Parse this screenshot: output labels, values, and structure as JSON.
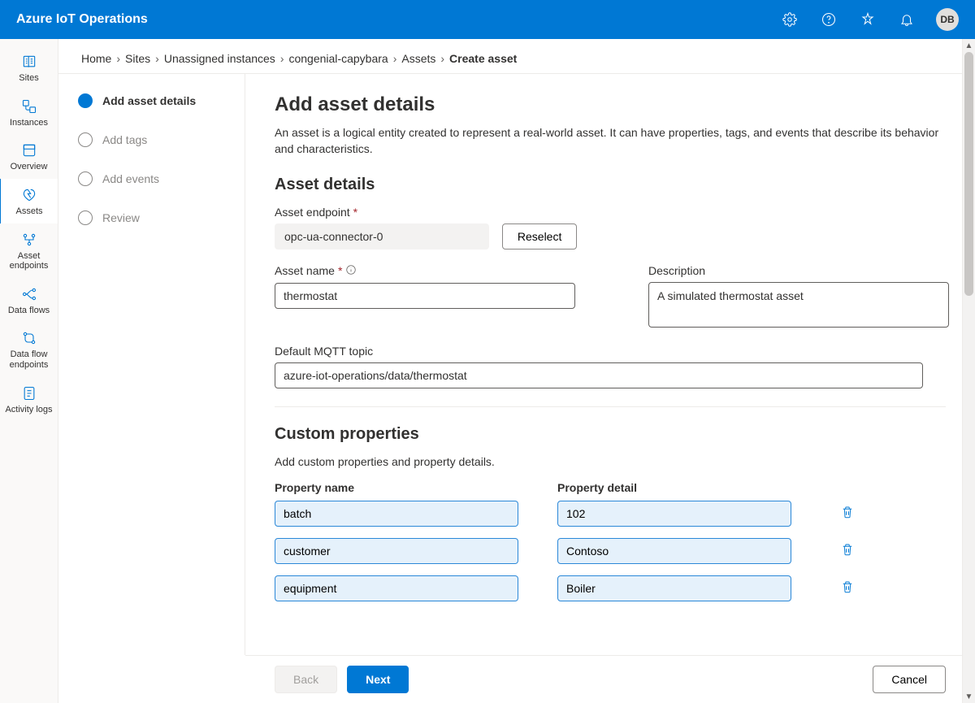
{
  "header": {
    "title": "Azure IoT Operations",
    "avatar_initials": "DB"
  },
  "nav": {
    "items": [
      {
        "id": "sites",
        "label": "Sites"
      },
      {
        "id": "instances",
        "label": "Instances"
      },
      {
        "id": "overview",
        "label": "Overview"
      },
      {
        "id": "assets",
        "label": "Assets"
      },
      {
        "id": "asset-endpoints",
        "label": "Asset endpoints"
      },
      {
        "id": "data-flows",
        "label": "Data flows"
      },
      {
        "id": "data-flow-endpoints",
        "label": "Data flow endpoints"
      },
      {
        "id": "activity-logs",
        "label": "Activity logs"
      }
    ]
  },
  "breadcrumbs": [
    "Home",
    "Sites",
    "Unassigned instances",
    "congenial-capybara",
    "Assets",
    "Create asset"
  ],
  "wizard": {
    "steps": [
      "Add asset details",
      "Add tags",
      "Add events",
      "Review"
    ]
  },
  "page": {
    "title": "Add asset details",
    "description": "An asset is a logical entity created to represent a real-world asset. It can have properties, tags, and events that describe its behavior and characteristics.",
    "section_asset_details": "Asset details",
    "asset_endpoint_label": "Asset endpoint",
    "asset_endpoint_value": "opc-ua-connector-0",
    "reselect_label": "Reselect",
    "asset_name_label": "Asset name",
    "asset_name_value": "thermostat",
    "description_label": "Description",
    "description_value": "A simulated thermostat asset",
    "mqtt_label": "Default MQTT topic",
    "mqtt_value": "azure-iot-operations/data/thermostat",
    "section_custom_props": "Custom properties",
    "custom_props_desc": "Add custom properties and property details.",
    "prop_name_header": "Property name",
    "prop_detail_header": "Property detail",
    "custom_properties": [
      {
        "name": "batch",
        "detail": "102"
      },
      {
        "name": "customer",
        "detail": "Contoso"
      },
      {
        "name": "equipment",
        "detail": "Boiler"
      }
    ]
  },
  "footer": {
    "back": "Back",
    "next": "Next",
    "cancel": "Cancel"
  }
}
